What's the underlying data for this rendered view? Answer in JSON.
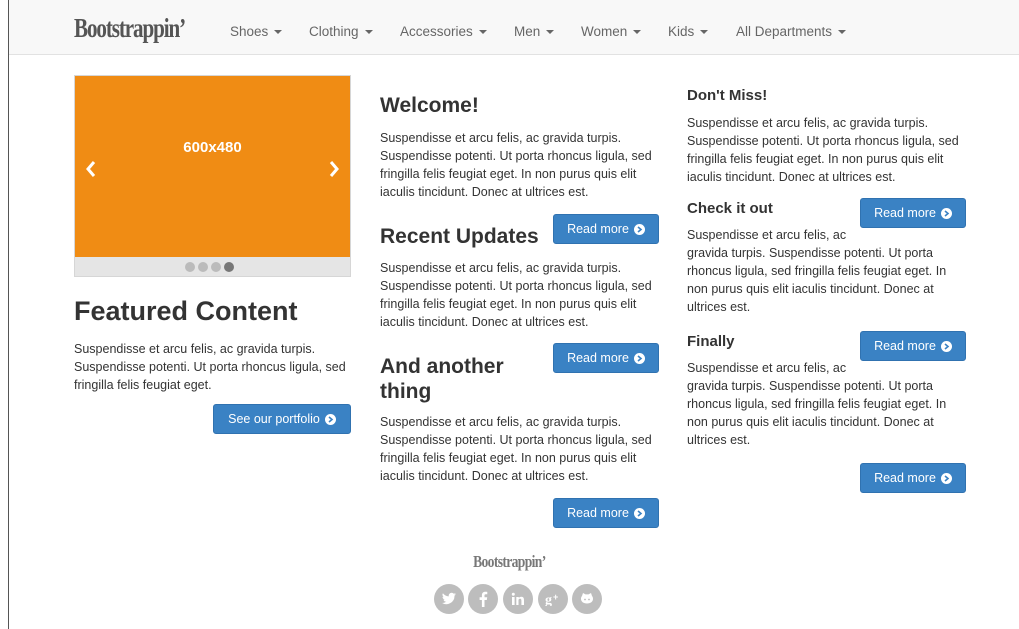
{
  "navbar": {
    "brand": "Bootstrappin’",
    "items": [
      {
        "label": "Shoes"
      },
      {
        "label": "Clothing"
      },
      {
        "label": "Accessories"
      },
      {
        "label": "Men"
      },
      {
        "label": "Women"
      },
      {
        "label": "Kids"
      },
      {
        "label": "All Departments"
      }
    ]
  },
  "carousel": {
    "label": "600x480",
    "slide_count": 4,
    "active_slide": 4,
    "background_color": "#f08c14"
  },
  "featured": {
    "title": "Featured Content",
    "text": "Suspendisse et arcu felis, ac gravida turpis. Suspendisse potenti. Ut porta rhoncus ligula, sed fringilla felis feugiat eget.",
    "button": "See our portfolio"
  },
  "middle": {
    "welcome": {
      "title": "Welcome!",
      "text": "Suspendisse et arcu felis, ac gravida turpis. Suspendisse potenti. Ut porta rhoncus ligula, sed fringilla felis feugiat eget. In non purus quis elit iaculis tincidunt. Donec at ultrices est.",
      "button": "Read more"
    },
    "recent": {
      "title": "Recent Updates",
      "text": "Suspendisse et arcu felis, ac gravida turpis. Suspendisse potenti. Ut porta rhoncus ligula, sed fringilla felis feugiat eget. In non purus quis elit iaculis tincidunt. Donec at ultrices est.",
      "button": "Read more"
    },
    "another": {
      "title_line1": "And another",
      "title_line2": "thing",
      "text": "Suspendisse et arcu felis, ac gravida turpis. Suspendisse potenti. Ut porta rhoncus ligula, sed fringilla felis feugiat eget. In non purus quis elit iaculis tincidunt. Donec at ultrices est.",
      "button": "Read more"
    }
  },
  "right": {
    "dont_miss": {
      "title": "Don't Miss!",
      "text": "Suspendisse et arcu felis, ac gravida turpis. Suspendisse potenti. Ut porta rhoncus ligula, sed fringilla felis feugiat eget. In non purus quis elit iaculis tincidunt. Donec at ultrices est.",
      "button": "Read more"
    },
    "check": {
      "title": "Check it out",
      "text_line1": "Suspendisse et arcu felis, ac",
      "text_rest": "gravida turpis. Suspendisse potenti. Ut porta rhoncus ligula, sed fringilla felis feugiat eget. In non purus quis elit iaculis tincidunt. Donec at ultrices est.",
      "button": "Read more"
    },
    "finally": {
      "title": "Finally",
      "text_line1": "Suspendisse et arcu felis, ac",
      "text_rest": "gravida turpis. Suspendisse potenti. Ut porta rhoncus ligula, sed fringilla felis feugiat eget. In non purus quis elit iaculis tincidunt. Donec at ultrices est.",
      "button": "Read more"
    }
  },
  "footer": {
    "brand": "Bootstrappin’",
    "social": [
      "twitter-icon",
      "facebook-icon",
      "linkedin-icon",
      "google-plus-icon",
      "github-icon"
    ]
  },
  "colors": {
    "button": "#3a82c4",
    "navbar": "#f8f8f8",
    "social": "#bdbdbd"
  }
}
